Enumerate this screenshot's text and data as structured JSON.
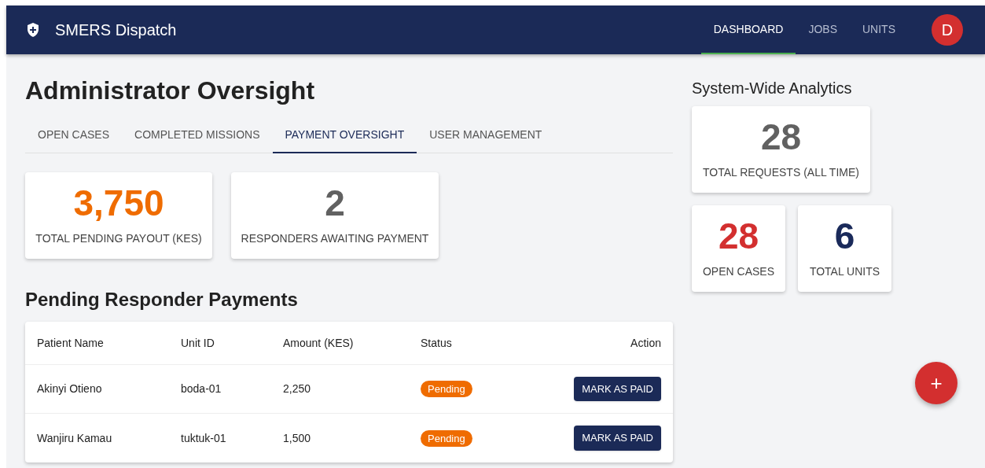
{
  "app": {
    "title": "SMERS Dispatch",
    "nav": [
      {
        "label": "DASHBOARD",
        "selected": true
      },
      {
        "label": "JOBS",
        "selected": false
      },
      {
        "label": "UNITS",
        "selected": false
      }
    ],
    "avatar": "D"
  },
  "page": {
    "title": "Administrator Oversight",
    "tabs": [
      {
        "label": "OPEN CASES",
        "selected": false
      },
      {
        "label": "COMPLETED MISSIONS",
        "selected": false
      },
      {
        "label": "PAYMENT OVERSIGHT",
        "selected": true
      },
      {
        "label": "USER MANAGEMENT",
        "selected": false
      }
    ],
    "stats": [
      {
        "value": "3,750",
        "label": "TOTAL PENDING PAYOUT (KES)",
        "color": "#ef6c00"
      },
      {
        "value": "2",
        "label": "RESPONDERS AWAITING PAYMENT",
        "color": "#616161"
      }
    ],
    "section_title": "Pending Responder Payments",
    "table": {
      "columns": [
        "Patient Name",
        "Unit ID",
        "Amount (KES)",
        "Status",
        "Action"
      ],
      "rows": [
        {
          "patient": "Akinyi Otieno",
          "unit": "boda-01",
          "amount": "2,250",
          "status": "Pending",
          "action": "MARK AS PAID"
        },
        {
          "patient": "Wanjiru Kamau",
          "unit": "tuktuk-01",
          "amount": "1,500",
          "status": "Pending",
          "action": "MARK AS PAID"
        }
      ]
    }
  },
  "analytics": {
    "title": "System-Wide Analytics",
    "total": {
      "value": "28",
      "label": "TOTAL REQUESTS (ALL TIME)",
      "color": "#616161"
    },
    "stats": [
      {
        "value": "28",
        "label": "OPEN CASES",
        "color": "#d32f2f"
      },
      {
        "value": "6",
        "label": "TOTAL UNITS",
        "color": "#1a2a5a"
      }
    ]
  },
  "fab": "+"
}
